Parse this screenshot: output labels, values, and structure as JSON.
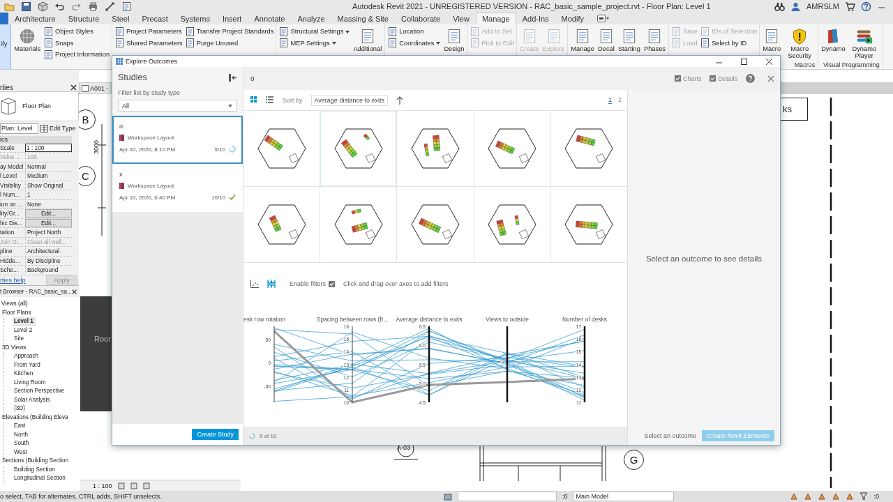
{
  "app": {
    "title": "Autodesk Revit 2021 - UNREGISTERED VERSION - RAC_basic_sample_project.rvt - Floor Plan: Level 1",
    "user": "AMRSLM"
  },
  "ribbon_tabs": [
    {
      "label": "Architecture",
      "selected": false
    },
    {
      "label": "Structure",
      "selected": false
    },
    {
      "label": "Steel",
      "selected": false
    },
    {
      "label": "Precast",
      "selected": false
    },
    {
      "label": "Systems",
      "selected": false
    },
    {
      "label": "Insert",
      "selected": false
    },
    {
      "label": "Annotate",
      "selected": false
    },
    {
      "label": "Analyze",
      "selected": false
    },
    {
      "label": "Massing & Site",
      "selected": false
    },
    {
      "label": "Collaborate",
      "selected": false
    },
    {
      "label": "View",
      "selected": false
    },
    {
      "label": "Manage",
      "selected": true
    },
    {
      "label": "Add-Ins",
      "selected": false
    },
    {
      "label": "Modify",
      "selected": false
    }
  ],
  "ribbon": [
    {
      "kind": "modify",
      "columns": [
        {
          "kind": "large",
          "tools": [
            {
              "label": "ify",
              "disabled": false,
              "dropdown": false
            }
          ]
        }
      ]
    },
    {
      "kind": "tools",
      "columns": [
        {
          "kind": "large",
          "tools": [
            {
              "label": "Materials",
              "disabled": false,
              "dropdown": false
            }
          ]
        },
        {
          "kind": "stack",
          "tools": [
            {
              "label": "Object Styles",
              "disabled": false,
              "dropdown": false
            },
            {
              "label": "Snaps",
              "disabled": false,
              "dropdown": false
            },
            {
              "label": "Project Information",
              "disabled": false,
              "dropdown": false
            }
          ]
        }
      ]
    },
    {
      "kind": "tools",
      "columns": [
        {
          "kind": "stack",
          "tools": [
            {
              "label": "Project Parameters",
              "disabled": false,
              "dropdown": false
            },
            {
              "label": "Shared Parameters",
              "disabled": false,
              "dropdown": false
            }
          ]
        },
        {
          "kind": "stack",
          "tools": [
            {
              "label": "Transfer Project Standards",
              "disabled": false,
              "dropdown": false
            },
            {
              "label": "Purge Unused",
              "disabled": false,
              "dropdown": false
            }
          ]
        }
      ]
    },
    {
      "kind": "tools",
      "columns": [
        {
          "kind": "stack",
          "tools": [
            {
              "label": "Structural Settings",
              "disabled": false,
              "dropdown": true
            },
            {
              "label": "MEP Settings",
              "disabled": false,
              "dropdown": true
            }
          ]
        },
        {
          "kind": "large",
          "tools": [
            {
              "label": "Additional",
              "disabled": false,
              "dropdown": false
            }
          ]
        }
      ]
    },
    {
      "kind": "tools",
      "columns": [
        {
          "kind": "stack",
          "tools": [
            {
              "label": "Location",
              "disabled": false,
              "dropdown": false
            },
            {
              "label": "Coordinates",
              "disabled": false,
              "dropdown": true
            }
          ]
        },
        {
          "kind": "large",
          "tools": [
            {
              "label": "Design",
              "disabled": false,
              "dropdown": false
            }
          ]
        }
      ]
    },
    {
      "kind": "tools",
      "columns": [
        {
          "kind": "stack",
          "tools": [
            {
              "label": "Add to Set",
              "disabled": true,
              "dropdown": false
            },
            {
              "label": "Pick to Edit",
              "disabled": true,
              "dropdown": false
            }
          ]
        }
      ]
    },
    {
      "kind": "tools",
      "columns": [
        {
          "kind": "large",
          "tools": [
            {
              "label": "Create",
              "disabled": true,
              "dropdown": false
            }
          ]
        },
        {
          "kind": "large",
          "tools": [
            {
              "label": "Explore",
              "disabled": true,
              "dropdown": false
            }
          ]
        }
      ]
    },
    {
      "kind": "tools",
      "columns": [
        {
          "kind": "large",
          "tools": [
            {
              "label": "Manage",
              "disabled": false,
              "dropdown": false
            }
          ]
        },
        {
          "kind": "large",
          "tools": [
            {
              "label": "Decal",
              "disabled": false,
              "dropdown": false
            }
          ]
        },
        {
          "kind": "large",
          "tools": [
            {
              "label": "Starting",
              "disabled": false,
              "dropdown": false
            }
          ]
        },
        {
          "kind": "large",
          "tools": [
            {
              "label": "Phases",
              "disabled": false,
              "dropdown": false
            }
          ]
        }
      ]
    },
    {
      "kind": "tools",
      "columns": [
        {
          "kind": "stack",
          "tools": [
            {
              "label": "Save",
              "disabled": true,
              "dropdown": false
            },
            {
              "label": "Load",
              "disabled": true,
              "dropdown": false
            }
          ]
        },
        {
          "kind": "stack",
          "tools": [
            {
              "label": "IDs of Selection",
              "disabled": true,
              "dropdown": false
            },
            {
              "label": "Select by ID",
              "disabled": false,
              "dropdown": false
            }
          ]
        }
      ]
    },
    {
      "kind": "tools",
      "label": "Macros",
      "columns": [
        {
          "kind": "large",
          "tools": [
            {
              "label": "Macro",
              "disabled": false,
              "dropdown": false
            }
          ]
        },
        {
          "kind": "large",
          "tools": [
            {
              "label": "Macro Security",
              "disabled": false,
              "dropdown": false
            }
          ]
        }
      ]
    },
    {
      "kind": "tools",
      "label": "Visual Programming",
      "columns": [
        {
          "kind": "large",
          "tools": [
            {
              "label": "Dynamo",
              "disabled": false,
              "dropdown": false
            }
          ]
        },
        {
          "kind": "large",
          "tools": [
            {
              "label": "Dynamo Player",
              "disabled": false,
              "dropdown": false
            }
          ]
        }
      ]
    }
  ],
  "properties": {
    "title": "rties",
    "type": "Floor Plan",
    "selector": "Plan: Level",
    "edit_type": "Edit Type",
    "section": "ics",
    "rows": [
      {
        "label": "Scale",
        "value": "1 : 100",
        "kind": "field",
        "disabled": false
      },
      {
        "label": "Value ...",
        "value": "100",
        "kind": "text",
        "disabled": true
      },
      {
        "label": "ay Model",
        "value": "Normal",
        "kind": "text",
        "disabled": false
      },
      {
        "label": "l Level",
        "value": "Medium",
        "kind": "text",
        "disabled": false
      },
      {
        "label": "Visibility",
        "value": "Show Original",
        "kind": "text",
        "disabled": false
      },
      {
        "label": "l Num...",
        "value": "1",
        "kind": "text",
        "disabled": false
      },
      {
        "label": "ion on ...",
        "value": "None",
        "kind": "text",
        "disabled": false
      },
      {
        "label": "lity/Gr...",
        "value": "Edit...",
        "kind": "button",
        "disabled": false
      },
      {
        "label": "hic Dis...",
        "value": "Edit...",
        "kind": "button",
        "disabled": false
      },
      {
        "label": "tation",
        "value": "Project North",
        "kind": "text",
        "disabled": false
      },
      {
        "label": "Join Di...",
        "value": "Clean all wall...",
        "kind": "text",
        "disabled": true
      },
      {
        "label": "pline",
        "value": "Architectural",
        "kind": "text",
        "disabled": false
      },
      {
        "label": "Hidde...",
        "value": "By Discipline",
        "kind": "text",
        "disabled": false
      },
      {
        "label": "Sche...",
        "value": "Background",
        "kind": "text",
        "disabled": false
      }
    ],
    "help": "rties help",
    "apply": "Apply"
  },
  "project_browser": {
    "title": "t Browser - RAC_basic_sa...",
    "tree": [
      {
        "label": "Views (all)",
        "selected": false,
        "children": [
          {
            "label": "Floor Plans",
            "selected": false,
            "children": [
              {
                "label": "Level 1",
                "selected": true
              },
              {
                "label": "Level 2",
                "selected": false
              },
              {
                "label": "Site",
                "selected": false
              }
            ]
          },
          {
            "label": "3D Views",
            "selected": false,
            "children": [
              {
                "label": "Approach",
                "selected": false
              },
              {
                "label": "From Yard",
                "selected": false
              },
              {
                "label": "Kitchen",
                "selected": false
              },
              {
                "label": "Living Room",
                "selected": false
              },
              {
                "label": "Section Perspective",
                "selected": false
              },
              {
                "label": "Solar Analysis",
                "selected": false
              },
              {
                "label": "{3D}",
                "selected": false
              }
            ]
          },
          {
            "label": "Elevations (Building Eleva",
            "selected": false,
            "children": [
              {
                "label": "East",
                "selected": false
              },
              {
                "label": "North",
                "selected": false
              },
              {
                "label": "South",
                "selected": false
              },
              {
                "label": "West",
                "selected": false
              }
            ]
          },
          {
            "label": "Sections (Building Section",
            "selected": false,
            "children": [
              {
                "label": "Building Section",
                "selected": false
              },
              {
                "label": "Longitudinal Section",
                "selected": false
              }
            ]
          }
        ]
      }
    ]
  },
  "view": {
    "tab": "A001 -",
    "bubbles": [
      "B",
      "C",
      "G"
    ],
    "dimension": "3000",
    "room": "Roor",
    "tag": "ks",
    "section_mark": "A-03",
    "scale": "1 : 100"
  },
  "status_bar": {
    "hint": "o select, TAB for alternates, CTRL adds, SHIFT unselects.",
    "count": ":0",
    "workset": "Main Model",
    "filter_count": ":0"
  },
  "explore_outcomes": {
    "title": "Explore Outcomes",
    "studies": {
      "title": "Studies",
      "filter_label": "Filter list by study type",
      "filter_value": "All",
      "create_button": "Create Study",
      "items": [
        {
          "name": "o",
          "type": "Workspace Layout",
          "date": "Apr 10, 2020, 8:10 PM",
          "progress": "5/10",
          "complete": false,
          "selected": true
        },
        {
          "name": "x",
          "type": "Workspace Layout",
          "date": "Apr 10, 2020, 6:40 PM",
          "progress": "10/10",
          "complete": true,
          "selected": false
        }
      ]
    },
    "study_name": "o",
    "options": [
      {
        "label": "Charts",
        "checked": true
      },
      {
        "label": "Details",
        "checked": true
      }
    ],
    "toolbar": {
      "views": [
        {
          "kind": "grid",
          "selected": true
        },
        {
          "kind": "list",
          "selected": false
        }
      ],
      "sort_label": "Sort by",
      "sort_value": "Average distance to exits",
      "pages": [
        {
          "label": "1",
          "selected": true
        },
        {
          "label": "2",
          "selected": false
        }
      ]
    },
    "outcomes": [
      {
        "hovered": false
      },
      {
        "hovered": true
      },
      {
        "hovered": false
      },
      {
        "hovered": false
      },
      {
        "hovered": false
      },
      {
        "hovered": false
      },
      {
        "hovered": false
      },
      {
        "hovered": false
      },
      {
        "hovered": false
      },
      {
        "hovered": false
      }
    ],
    "chart_panel": {
      "views": [
        {
          "kind": "scatter",
          "selected": false
        },
        {
          "kind": "parallel",
          "selected": true
        }
      ],
      "enable_filters": {
        "label": "Enable filters",
        "checked": true
      },
      "hint": "Click and drag over axes to add filters",
      "axes": [
        {
          "label": "esk row rotation",
          "ticks": [
            "50",
            "0",
            "-50"
          ]
        },
        {
          "label": "Spacing between rows (ft...",
          "ticks": [
            "16",
            "15",
            "14",
            "13",
            "12",
            "11",
            "10"
          ]
        },
        {
          "label": "Average distance to exits",
          "ticks": [
            "6.5",
            "6.0",
            "5.5",
            "5.0",
            "4.5"
          ]
        },
        {
          "label": "Views to outside",
          "ticks": [
            "9"
          ]
        },
        {
          "label": "Number of desks",
          "ticks": [
            "17",
            "16",
            "15",
            "14",
            "13",
            "12",
            "11"
          ]
        }
      ],
      "progress": "5 of 10"
    },
    "details": {
      "empty_text": "Select an outcome to see details",
      "status": "Select an outcome",
      "create_button": "Create Revit Elements"
    }
  }
}
